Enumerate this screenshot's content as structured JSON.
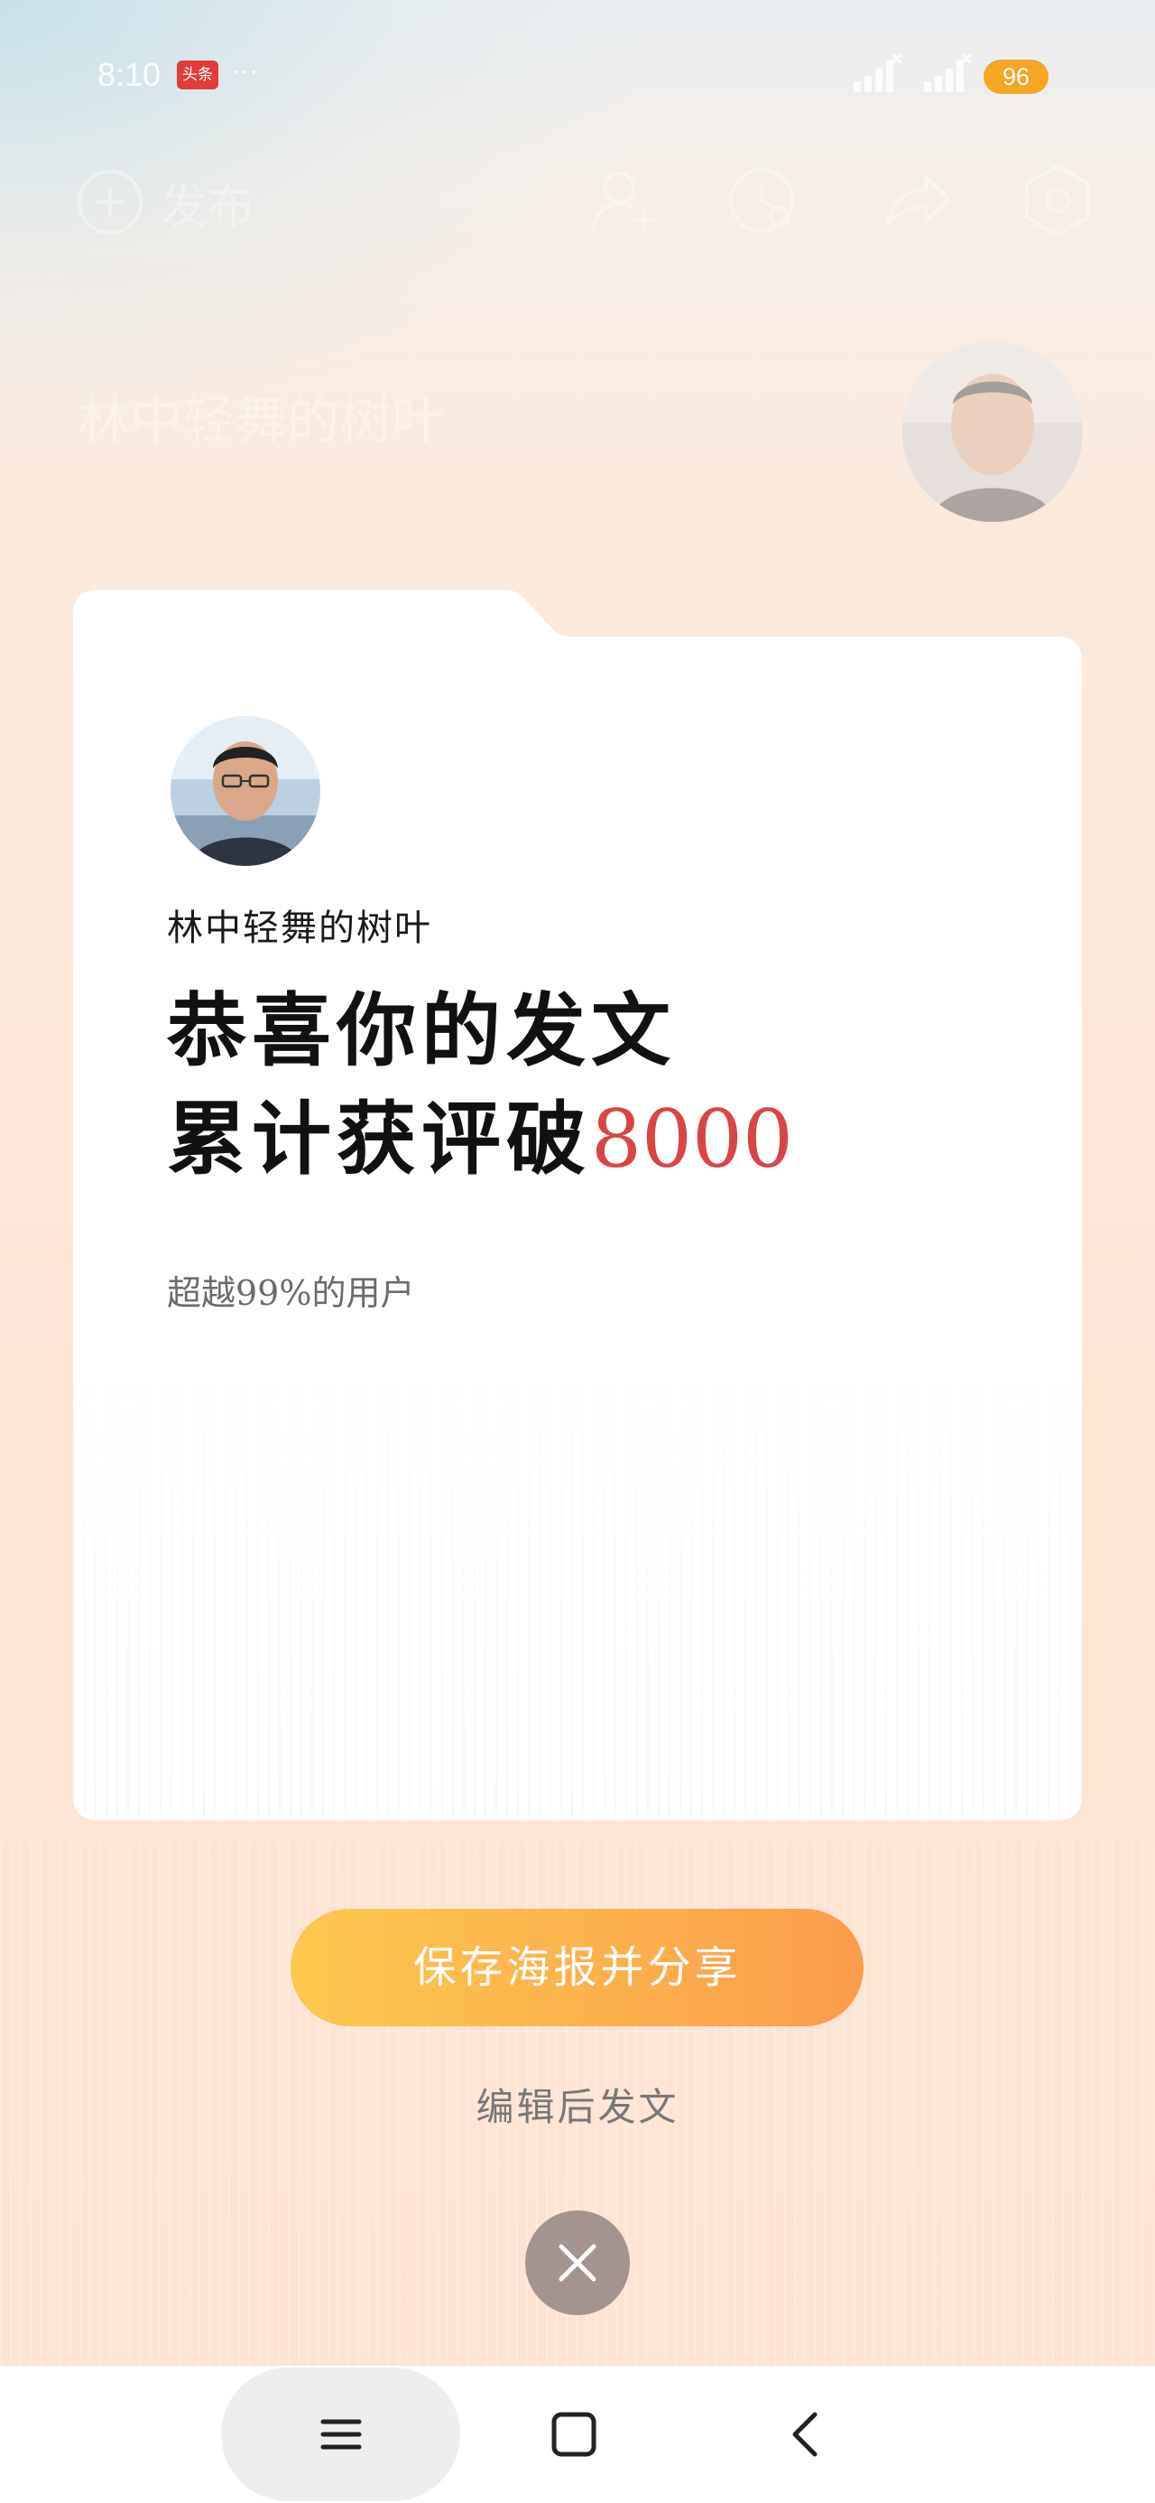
{
  "status_bar": {
    "time": "8:10",
    "app_badge": "头条",
    "more_dots": "···",
    "battery": "96"
  },
  "header": {
    "publish_label": "发布",
    "profile_name": "林中轻舞的树叶"
  },
  "card": {
    "username": "林中轻舞的树叶",
    "headline_line1": "恭喜你的发文",
    "headline_line2_prefix": "累计获评破",
    "headline_line2_number": "8000",
    "subtext": "超越99%的用户"
  },
  "actions": {
    "primary_button": "保存海报并分享",
    "secondary_link": "编辑后发文"
  },
  "colors": {
    "highlight": "#d94545",
    "button_start": "#fdc84f",
    "button_end": "#fb9c4c",
    "battery": "#f5a623"
  }
}
